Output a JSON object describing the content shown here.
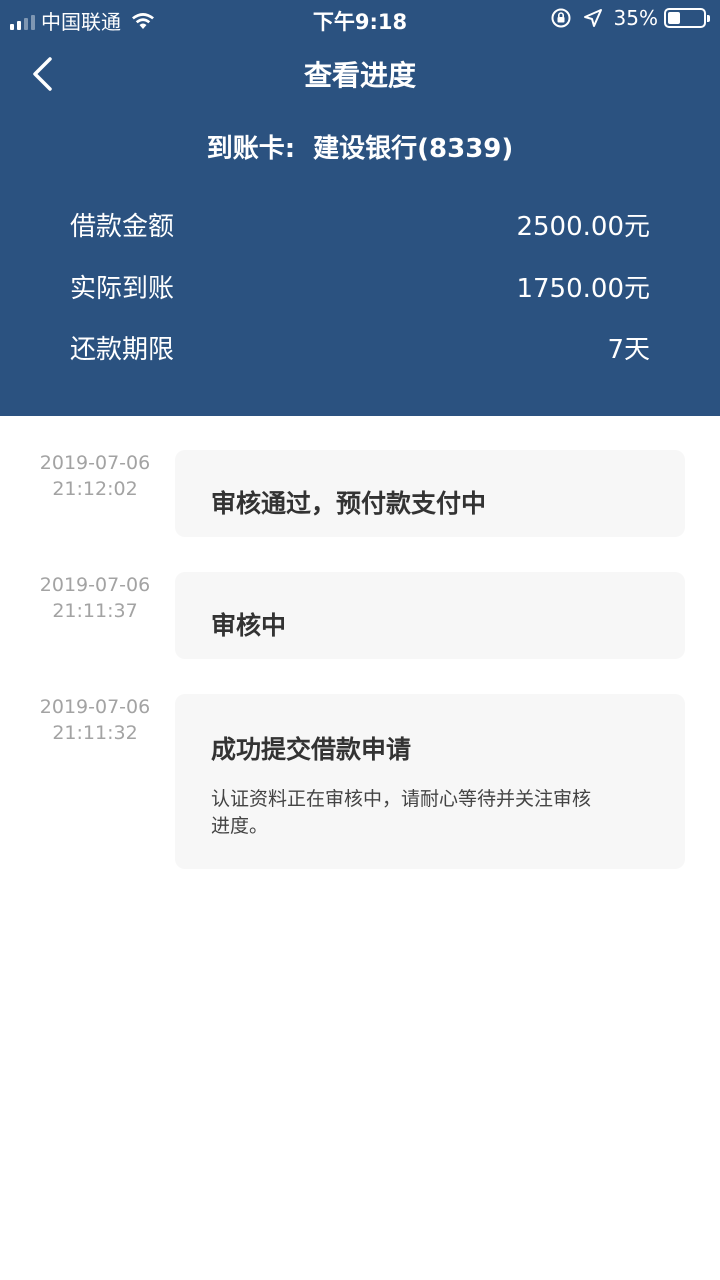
{
  "status_bar": {
    "carrier": "中国联通",
    "time": "下午9:18",
    "battery_percent": "35%",
    "battery_level": 0.35
  },
  "nav": {
    "title": "查看进度"
  },
  "summary": {
    "card_label": "到账卡:",
    "card_value": "建设银行(8339)",
    "rows": [
      {
        "label": "借款金额",
        "value": "2500.00元"
      },
      {
        "label": "实际到账",
        "value": "1750.00元"
      },
      {
        "label": "还款期限",
        "value": "7天"
      }
    ]
  },
  "timeline": [
    {
      "date": "2019-07-06",
      "time": "21:12:02",
      "title": "审核通过，预付款支付中",
      "desc": ""
    },
    {
      "date": "2019-07-06",
      "time": "21:11:37",
      "title": "审核中",
      "desc": ""
    },
    {
      "date": "2019-07-06",
      "time": "21:11:32",
      "title": "成功提交借款申请",
      "desc": "认证资料正在审核中，请耐心等待并关注审核进度。"
    }
  ],
  "colors": {
    "header_bg": "#2b5280",
    "card_bg": "#f7f7f7",
    "timestamp": "#a3a3a3"
  }
}
